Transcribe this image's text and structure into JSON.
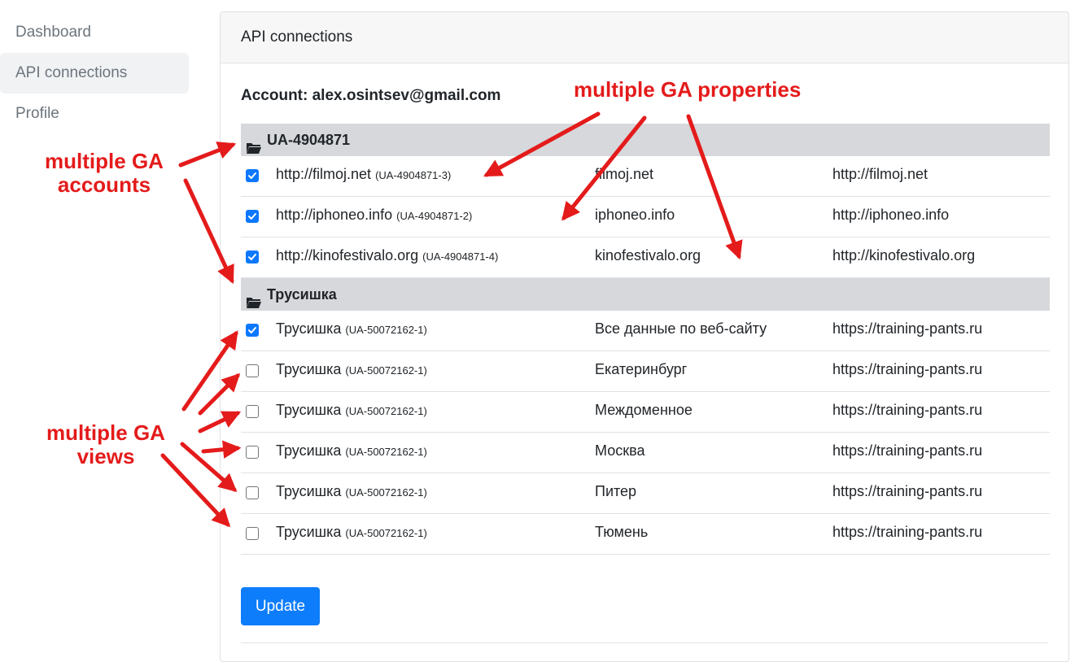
{
  "sidebar": {
    "items": [
      {
        "label": "Dashboard",
        "active": false
      },
      {
        "label": "API connections",
        "active": true
      },
      {
        "label": "Profile",
        "active": false
      }
    ]
  },
  "card": {
    "title": "API connections",
    "account_label": "Account: alex.osintsev@gmail.com"
  },
  "groups": [
    {
      "name": "UA-4904871",
      "rows": [
        {
          "checked": true,
          "url": "http://filmoj.net",
          "id": "(UA-4904871-3)",
          "view": "filmoj.net",
          "site": "http://filmoj.net"
        },
        {
          "checked": true,
          "url": "http://iphoneo.info",
          "id": "(UA-4904871-2)",
          "view": "iphoneo.info",
          "site": "http://iphoneo.info"
        },
        {
          "checked": true,
          "url": "http://kinofestivalo.org",
          "id": "(UA-4904871-4)",
          "view": "kinofestivalo.org",
          "site": "http://kinofestivalo.org"
        }
      ]
    },
    {
      "name": "Трусишка",
      "rows": [
        {
          "checked": true,
          "url": "Трусишка",
          "id": "(UA-50072162-1)",
          "view": "Все данные по веб-сайту",
          "site": "https://training-pants.ru"
        },
        {
          "checked": false,
          "url": "Трусишка",
          "id": "(UA-50072162-1)",
          "view": "Екатеринбург",
          "site": "https://training-pants.ru"
        },
        {
          "checked": false,
          "url": "Трусишка",
          "id": "(UA-50072162-1)",
          "view": "Междоменное",
          "site": "https://training-pants.ru"
        },
        {
          "checked": false,
          "url": "Трусишка",
          "id": "(UA-50072162-1)",
          "view": "Москва",
          "site": "https://training-pants.ru"
        },
        {
          "checked": false,
          "url": "Трусишка",
          "id": "(UA-50072162-1)",
          "view": "Питер",
          "site": "https://training-pants.ru"
        },
        {
          "checked": false,
          "url": "Трусишка",
          "id": "(UA-50072162-1)",
          "view": "Тюмень",
          "site": "https://training-pants.ru"
        }
      ]
    }
  ],
  "update_button": "Update",
  "annotations": {
    "properties": "multiple GA properties",
    "accounts_line1": "multiple GA",
    "accounts_line2": "accounts",
    "views_line1": "multiple GA",
    "views_line2": "views"
  },
  "colors": {
    "accent": "#0d7dfb",
    "annotation": "#e41b1b",
    "group_header_bg": "#d6d8db"
  }
}
